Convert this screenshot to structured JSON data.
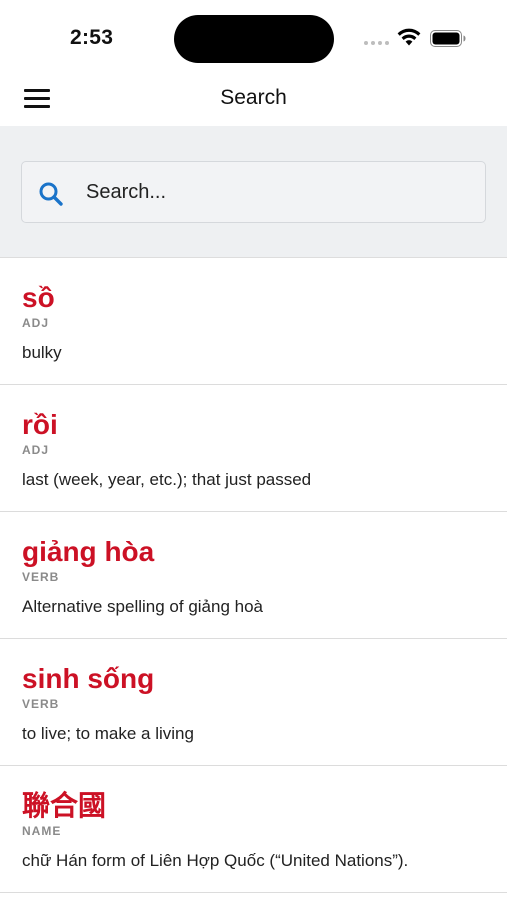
{
  "status_bar": {
    "time": "2:53",
    "icons": [
      "wifi-icon",
      "battery-icon"
    ]
  },
  "header": {
    "title": "Search",
    "menu_icon": "hamburger-menu-icon"
  },
  "search": {
    "placeholder": "Search...",
    "value": "",
    "icon": "search-icon",
    "icon_color": "#1a73c9"
  },
  "colors": {
    "headword": "#cc1125",
    "search_bg": "#eef0f2"
  },
  "results": [
    {
      "word": "sồ",
      "pos": "ADJ",
      "definition": "bulky"
    },
    {
      "word": "rồi",
      "pos": "ADJ",
      "definition": "last (week, year, etc.); that just passed"
    },
    {
      "word": "giảng hòa",
      "pos": "VERB",
      "definition": "Alternative spelling of giảng hoà"
    },
    {
      "word": "sinh sống",
      "pos": "VERB",
      "definition": "to live; to make a living"
    },
    {
      "word": "聯合國",
      "pos": "NAME",
      "definition": "chữ Hán form of Liên Hợp Quốc (“United Nations”)."
    }
  ]
}
